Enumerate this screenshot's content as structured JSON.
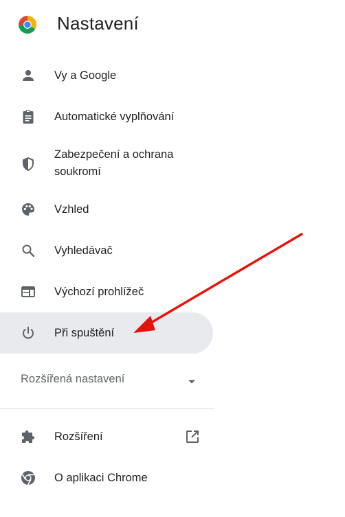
{
  "header": {
    "title": "Nastavení",
    "logo": "chrome-logo"
  },
  "nav": {
    "items": [
      {
        "label": "Vy a Google",
        "icon": "person-icon"
      },
      {
        "label": "Automatické vyplňování",
        "icon": "clipboard-icon"
      },
      {
        "label_line1": "Zabezpečení a ochrana",
        "label_line2": "soukromí",
        "icon": "shield-icon"
      },
      {
        "label": "Vzhled",
        "icon": "palette-icon"
      },
      {
        "label": "Vyhledávač",
        "icon": "search-icon"
      },
      {
        "label": "Výchozí prohlížeč",
        "icon": "browser-window-icon"
      },
      {
        "label": "Při spuštění",
        "icon": "power-icon",
        "active": true
      }
    ],
    "advanced": {
      "label": "Rozšířená nastavení",
      "icon": "caret-down-icon"
    },
    "footer_items": [
      {
        "label": "Rozšíření",
        "icon": "puzzle-icon",
        "trailing_icon": "open-in-new-icon"
      },
      {
        "label": "O aplikaci Chrome",
        "icon": "chrome-icon"
      }
    ]
  },
  "annotation": {
    "type": "arrow",
    "color": "#e8120c"
  },
  "colors": {
    "active_bg": "#e8eaed",
    "text": "#202124",
    "icon": "#5f6368",
    "divider": "#dadce0"
  }
}
